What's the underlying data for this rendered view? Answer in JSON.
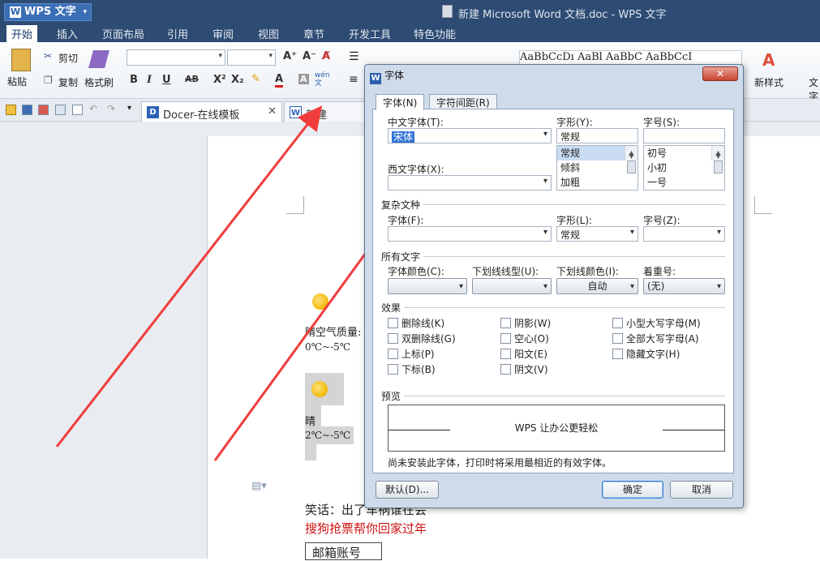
{
  "app": {
    "name": "WPS 文字",
    "window_title": "新建 Microsoft Word 文档.doc - WPS 文字"
  },
  "menu": [
    "开始",
    "插入",
    "页面布局",
    "引用",
    "审阅",
    "视图",
    "章节",
    "开发工具",
    "特色功能"
  ],
  "ribbon": {
    "paste": "粘贴",
    "cut": "剪切",
    "copy": "复制",
    "format_painter": "格式刷",
    "new_style": "新样式",
    "text_tools": "文字",
    "style_samples": "AaBbCcDı AaBl AaBbC AaBbCcI",
    "bold": "B",
    "italic": "I",
    "underline": "U",
    "strike": "AB",
    "sup": "X²",
    "sub": "X₂",
    "phonetic": "wén 文"
  },
  "tabs": [
    {
      "label": "Docer-在线模板"
    },
    {
      "label": "新建 Micr..."
    }
  ],
  "document": {
    "air_quality": "晴空气质量:",
    "temp1": "0℃~-5℃",
    "weather2": "晴",
    "temp2": "2℃~-5℃",
    "joke": "笑话：出了车祸谁在会",
    "ad": "搜狗抢票帮你回家过年",
    "email": "邮箱账号"
  },
  "dialog": {
    "title": "字体",
    "close": "✕",
    "tabs": [
      "字体(N)",
      "字符间距(R)"
    ],
    "cn_font_label": "中文字体(T):",
    "cn_font_value": "宋体",
    "style_label": "字形(Y):",
    "style_value": "常规",
    "style_options": [
      "常规",
      "倾斜",
      "加粗"
    ],
    "size_label": "字号(S):",
    "size_value": "",
    "size_options": [
      "初号",
      "小初",
      "一号"
    ],
    "west_font_label": "西文字体(X):",
    "west_font_value": "",
    "complex_section": "复杂文种",
    "complex_font_label": "字体(F):",
    "complex_font_value": "",
    "complex_style_label": "字形(L):",
    "complex_style_value": "常规",
    "complex_size_label": "字号(Z):",
    "complex_size_value": "",
    "all_text_section": "所有文字",
    "color_label": "字体颜色(C):",
    "underline_label": "下划线线型(U):",
    "underline_color_label": "下划线颜色(I):",
    "emphasis_label": "着重号:",
    "underline_color_value": "自动",
    "emphasis_value": "(无)",
    "effects_section": "效果",
    "effects": [
      [
        "删除线(K)",
        "阴影(W)",
        "小型大写字母(M)"
      ],
      [
        "双删除线(G)",
        "空心(O)",
        "全部大写字母(A)"
      ],
      [
        "上标(P)",
        "阳文(E)",
        "隐藏文字(H)"
      ],
      [
        "下标(B)",
        "阴文(V)",
        ""
      ]
    ],
    "preview_section": "预览",
    "preview_text": "WPS 让办公更轻松",
    "note": "尚未安装此字体，打印时将采用最相近的有效字体。",
    "default_btn": "默认(D)...",
    "ok_btn": "确定",
    "cancel_btn": "取消"
  }
}
